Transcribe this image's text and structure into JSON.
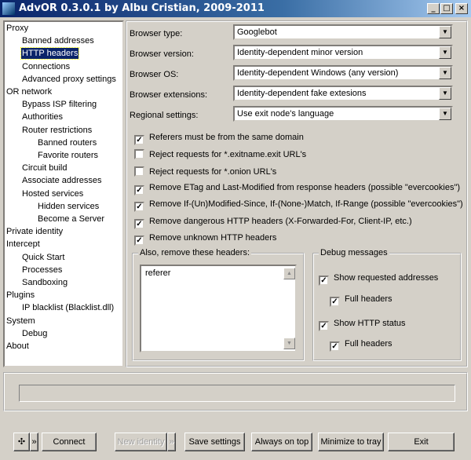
{
  "window": {
    "title": "AdvOR  0.3.0.1 by Albu Cristian, 2009-2011",
    "minimize": "_",
    "maximize": "□",
    "close": "×"
  },
  "tree": [
    {
      "label": "Proxy",
      "level": 0
    },
    {
      "label": "Banned addresses",
      "level": 1
    },
    {
      "label": "HTTP headers",
      "level": 1,
      "selected": true
    },
    {
      "label": "Connections",
      "level": 1
    },
    {
      "label": "Advanced proxy settings",
      "level": 1
    },
    {
      "label": "OR network",
      "level": 0
    },
    {
      "label": "Bypass ISP filtering",
      "level": 1
    },
    {
      "label": "Authorities",
      "level": 1
    },
    {
      "label": "Router restrictions",
      "level": 1
    },
    {
      "label": "Banned routers",
      "level": 2
    },
    {
      "label": "Favorite routers",
      "level": 2
    },
    {
      "label": "Circuit build",
      "level": 1
    },
    {
      "label": "Associate addresses",
      "level": 1
    },
    {
      "label": "Hosted services",
      "level": 1
    },
    {
      "label": "Hidden services",
      "level": 2
    },
    {
      "label": "Become a Server",
      "level": 2
    },
    {
      "label": "Private identity",
      "level": 0
    },
    {
      "label": "Intercept",
      "level": 0
    },
    {
      "label": "Quick Start",
      "level": 1
    },
    {
      "label": "Processes",
      "level": 1
    },
    {
      "label": "Sandboxing",
      "level": 1
    },
    {
      "label": "Plugins",
      "level": 0
    },
    {
      "label": "IP blacklist (Blacklist.dll)",
      "level": 1
    },
    {
      "label": "System",
      "level": 0
    },
    {
      "label": "Debug",
      "level": 1
    },
    {
      "label": "About",
      "level": 0
    }
  ],
  "settings": [
    {
      "label": "Browser type:",
      "value": "Googlebot"
    },
    {
      "label": "Browser version:",
      "value": "Identity-dependent minor version"
    },
    {
      "label": "Browser OS:",
      "value": "Identity-dependent Windows (any version)"
    },
    {
      "label": "Browser extensions:",
      "value": "Identity-dependent fake extesions"
    },
    {
      "label": "Regional settings:",
      "value": "Use exit node's language"
    }
  ],
  "options": [
    {
      "label": "Referers must be from the same domain",
      "checked": true
    },
    {
      "label": "Reject requests for *.exitname.exit URL's",
      "checked": false
    },
    {
      "label": "Reject requests for *.onion URL's",
      "checked": false
    },
    {
      "label": "Remove ETag and Last-Modified from response headers (possible \"evercookies\")",
      "checked": true
    },
    {
      "label": "Remove If-(Un)Modified-Since, If-(None-)Match, If-Range (possible \"evercookies\")",
      "checked": true
    },
    {
      "label": "Remove dangerous HTTP headers (X-Forwarded-For, Client-IP, etc.)",
      "checked": true
    },
    {
      "label": "Remove unknown HTTP headers",
      "checked": true
    }
  ],
  "remove_headers": {
    "title": "Also, remove these headers:",
    "value": "referer"
  },
  "debug": {
    "title": "Debug messages",
    "items": [
      {
        "label": "Show requested addresses",
        "checked": true
      },
      {
        "label": "Full headers",
        "checked": true
      },
      {
        "label": "Show HTTP status",
        "checked": true
      },
      {
        "label": "Full headers",
        "checked": true
      }
    ]
  },
  "status_text": "",
  "buttons": {
    "more": "»",
    "connect": "Connect",
    "new_identity": "New identity",
    "more2": "»",
    "save": "Save settings",
    "on_top": "Always on top",
    "tray": "Minimize to tray",
    "exit": "Exit"
  }
}
